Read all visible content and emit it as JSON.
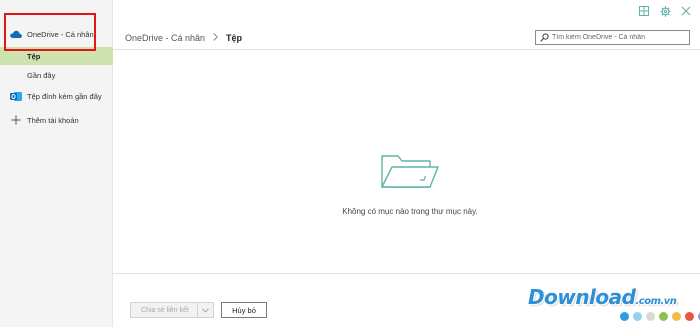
{
  "sidebar": {
    "account_label": "OneDrive - Cá nhân",
    "items": [
      {
        "label": "Tệp",
        "selected": true
      },
      {
        "label": "Gần đây",
        "selected": false
      }
    ],
    "attachments_label": "Tệp đính kèm gần đây",
    "add_account_label": "Thêm tài khoản"
  },
  "header": {
    "breadcrumb_root": "OneDrive - Cá nhân",
    "breadcrumb_current": "Tệp",
    "search_placeholder": "Tìm kiếm OneDrive - Cá nhân"
  },
  "main": {
    "empty_message": "Không có mục nào trong thư mục này."
  },
  "footer": {
    "share_link_label": "Chia sẻ liên kết",
    "cancel_label": "Hủy bỏ"
  },
  "watermark": {
    "text": "Download",
    "domain": ".com.vn",
    "dot_colors": [
      "#2f9be0",
      "#9ad0ef",
      "#d9d9d9",
      "#8cc152",
      "#f6bb42",
      "#e9573f",
      "#9a8fd6",
      "#4a89dc"
    ]
  },
  "colors": {
    "selected_bg": "#cfe3b0",
    "onedrive_blue": "#0f6cbd",
    "highlight_red": "#e2151b",
    "icon_teal": "#5fb3a7"
  },
  "icons": {
    "layout": "layout-grid-icon",
    "settings": "gear-icon",
    "close": "close-icon",
    "cloud": "cloud-icon",
    "outlook": "outlook-icon",
    "add": "plus-icon",
    "search": "search-icon",
    "folder": "empty-folder-icon"
  }
}
